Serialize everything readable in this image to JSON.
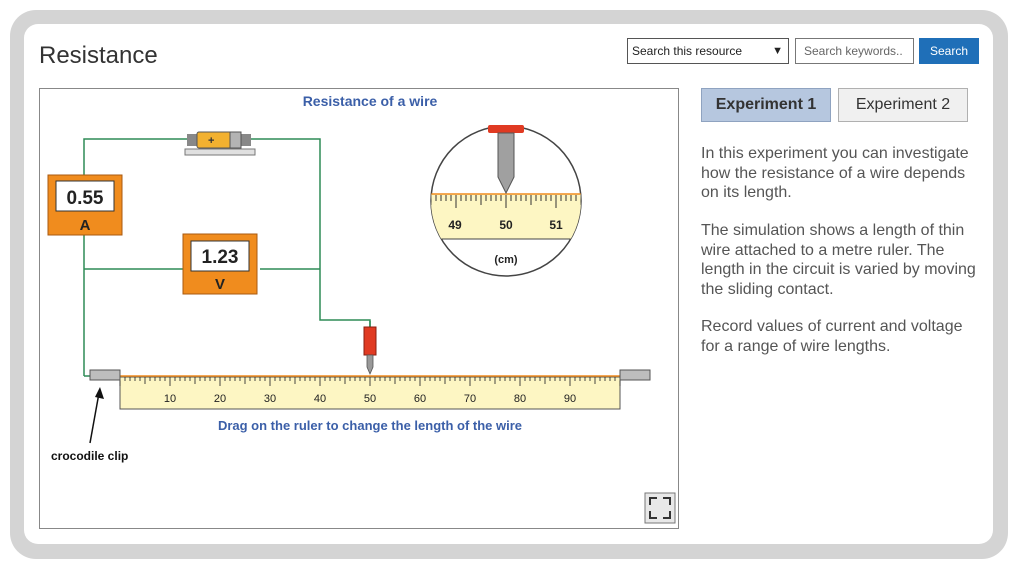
{
  "page": {
    "title": "Resistance"
  },
  "search": {
    "scope_label": "Search this resource",
    "placeholder": "Search keywords..",
    "button_label": "Search"
  },
  "simulation": {
    "title": "Resistance of a wire",
    "ammeter": {
      "value": "0.55",
      "unit": "A"
    },
    "voltmeter": {
      "value": "1.23",
      "unit": "V"
    },
    "magnifier": {
      "labels": [
        "49",
        "50",
        "51"
      ],
      "unit": "(cm)"
    },
    "ruler": {
      "labels": [
        "10",
        "20",
        "30",
        "40",
        "50",
        "60",
        "70",
        "80",
        "90"
      ],
      "contact_position_cm": 50
    },
    "instruction": "Drag on the ruler to change the length of the wire",
    "clip_label": "crocodile clip",
    "colors": {
      "wire": "#2e8b57",
      "meter": "#f08c1e",
      "ruler": "#fdf6c3",
      "contact": "#e03a22",
      "title": "#3b5fa8"
    }
  },
  "tabs": [
    {
      "label": "Experiment 1"
    },
    {
      "label": "Experiment 2"
    }
  ],
  "description": [
    "In this experiment you can investigate how the resistance of a wire depends on its length.",
    "The simulation shows a length of thin wire attached to a metre ruler. The length in the circuit is varied by moving the sliding contact.",
    "Record values of current and voltage for a range of wire lengths."
  ],
  "icons": {
    "fullscreen": "fullscreen-icon",
    "select_arrow": "chevron-down-icon"
  }
}
